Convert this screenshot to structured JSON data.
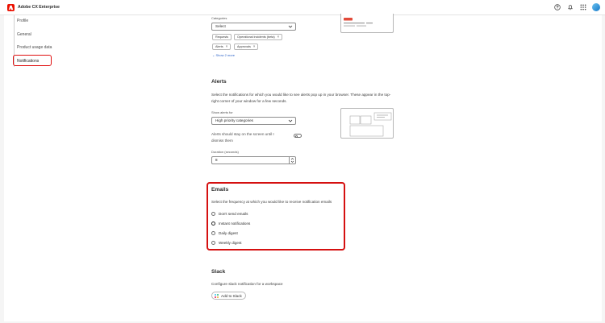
{
  "app": {
    "title": "Adobe CX Enterprise"
  },
  "header_icons": [
    "help-icon",
    "bell-icon",
    "apps-grid-icon",
    "avatar"
  ],
  "sidebar": {
    "items": [
      {
        "label": "Profile"
      },
      {
        "label": "General"
      },
      {
        "label": "Product usage data"
      },
      {
        "label": "Notifications",
        "selected": true
      }
    ]
  },
  "categories": {
    "label": "Categories",
    "select_value": "Select",
    "tags": [
      "Requests",
      "Operational incidents (beta)",
      "Alerts",
      "Approvals"
    ],
    "show_more": "Show 2 more"
  },
  "alerts": {
    "title": "Alerts",
    "description": "Select the notifications for which you would like to see alerts pop up in your browser. These appear in the top-right corner of your window for a few seconds.",
    "show_for_label": "Show alerts for",
    "show_for_value": "High priority categories",
    "stay_label": "Alerts should stay on the screen until I dismiss them",
    "stay_on": false,
    "duration_label": "Duration (seconds)",
    "duration_value": "8"
  },
  "emails": {
    "title": "Emails",
    "description": "Select the frequency at which you would like to receive notification emails",
    "options": [
      "Don't send emails",
      "Instant notifications",
      "Daily digest",
      "Weekly digest"
    ],
    "selected": "Instant notifications"
  },
  "slack": {
    "title": "Slack",
    "description": "Configure slack notification for a workspace",
    "button_label": "Add to Slack"
  },
  "colors": {
    "accent_red": "#e01010",
    "adobe_red": "#eb1000",
    "link_blue": "#2e64c8"
  }
}
